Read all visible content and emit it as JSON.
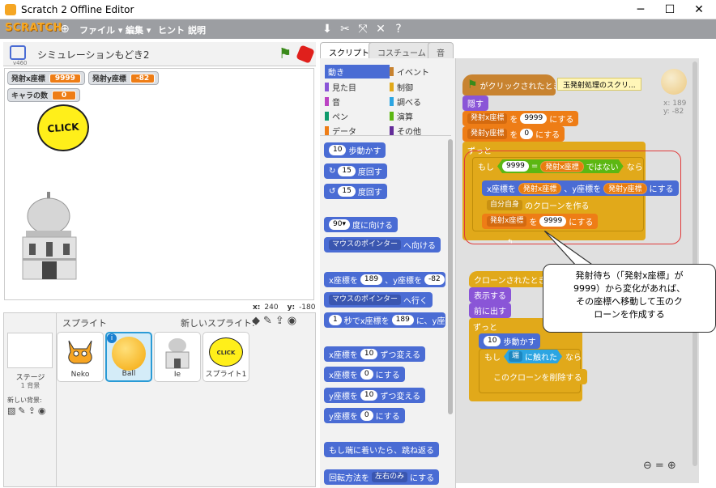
{
  "window": {
    "title": "Scratch 2 Offline Editor",
    "minimize": "─",
    "maximize": "☐",
    "close": "✕"
  },
  "menubar": {
    "logo": "SCRATCH",
    "file": "ファイル ▾",
    "edit": "編集 ▾",
    "hint": "ヒント",
    "about": "説明"
  },
  "stage": {
    "version": "v460",
    "project_title": "シミュレーションもどき2",
    "monitors": [
      {
        "label": "発射x座標",
        "value": "9999"
      },
      {
        "label": "発射y座標",
        "value": "-82"
      },
      {
        "label": "キャラの数",
        "value": "0"
      }
    ],
    "click_label": "CLICK",
    "coords": {
      "x_label": "x:",
      "x": "240",
      "y_label": "y:",
      "y": "-180"
    }
  },
  "sprites": {
    "header": "スプライト",
    "new_sprite": "新しいスプライト:",
    "stage_label": "ステージ",
    "stage_sub": "1 背景",
    "new_backdrop": "新しい背景:",
    "items": [
      {
        "name": "Neko"
      },
      {
        "name": "Ball"
      },
      {
        "name": "Ie"
      },
      {
        "name": "スプライト1"
      }
    ]
  },
  "tabs": {
    "script": "スクリプト",
    "costume": "コスチューム",
    "sound": "音"
  },
  "categories": [
    {
      "label": "動き",
      "color": "#4a6cd4"
    },
    {
      "label": "イベント",
      "color": "#c88330"
    },
    {
      "label": "見た目",
      "color": "#8a55d7"
    },
    {
      "label": "制御",
      "color": "#e1a91a"
    },
    {
      "label": "音",
      "color": "#bb42c3"
    },
    {
      "label": "調べる",
      "color": "#2ca5e2"
    },
    {
      "label": "ペン",
      "color": "#0e9a6c"
    },
    {
      "label": "演算",
      "color": "#5cb712"
    },
    {
      "label": "データ",
      "color": "#ee7d16"
    },
    {
      "label": "その他",
      "color": "#632d99"
    }
  ],
  "palette": {
    "move_val": "10",
    "move_label": "歩動かす",
    "turn_r_val": "15",
    "turn_r_label": "度回す",
    "turn_l_val": "15",
    "turn_l_label": "度回す",
    "point_val": "90▾",
    "point_label": "度に向ける",
    "point_towards": "マウスのポインター",
    "point_towards_label": "へ向ける",
    "goto_xy_a": "x座標を",
    "goto_xy_x": "189",
    "goto_xy_b": "、y座標を",
    "goto_xy_y": "-82",
    "goto_xy_c": "にす",
    "goto_target": "マウスのポインター",
    "goto_label": "へ行く",
    "glide_val": "1",
    "glide_a": "秒でx座標を",
    "glide_x": "189",
    "glide_b": "に、y座標を",
    "change_x_a": "x座標を",
    "change_x_val": "10",
    "change_x_b": "ずつ変える",
    "set_x_a": "x座標を",
    "set_x_val": "0",
    "set_x_b": "にする",
    "change_y_a": "y座標を",
    "change_y_val": "10",
    "change_y_b": "ずつ変える",
    "set_y_a": "y座標を",
    "set_y_val": "0",
    "set_y_b": "にする",
    "bounce": "もし端に着いたら、跳ね返る",
    "rotation_a": "回転方法を",
    "rotation_val": "左右のみ",
    "rotation_b": "にする"
  },
  "scripts": {
    "hat_flag": "がクリックされたとき",
    "comment": "玉発射処理のスクリ...",
    "sprite_x": "x: 189",
    "sprite_y": "y: -82",
    "hide": "隠す",
    "set_var1": "発射x座標",
    "set_to": "を",
    "set_val1": "9999",
    "set_suffix": "にする",
    "set_var2": "発射y座標",
    "set_val2": "0",
    "forever": "ずっと",
    "if": "もし",
    "cmp_left": "9999",
    "eq": "=",
    "cmp_right": "発射x座標",
    "not": "ではない",
    "then": "なら",
    "goto_a": "x座標を",
    "goto_x": "発射x座標",
    "goto_b": "、y座標を",
    "goto_y": "発射y座標",
    "goto_c": "にする",
    "clone_target": "自分自身",
    "clone_label": "のクローンを作る",
    "set_var3": "発射x座標",
    "set_val3": "9999",
    "clone_hat": "クローンされたとき",
    "show": "表示する",
    "front": "前に出す",
    "forever2": "ずっと",
    "move_val": "10",
    "move_label": "歩動かす",
    "if2": "もし",
    "touch_target": "端",
    "touch_label": "に触れた",
    "then2": "なら",
    "delete_clone": "このクローンを削除する"
  },
  "bubble": {
    "line1": "発射待ち（「発射x座標」が",
    "line2": "9999）から変化があれば、",
    "line3": "その座標へ移動して玉のク",
    "line4": "ローンを作成する"
  }
}
